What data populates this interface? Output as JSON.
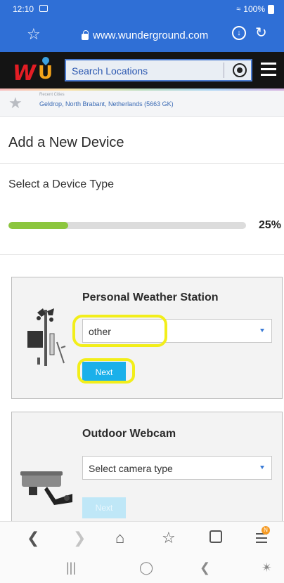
{
  "status_bar": {
    "time": "12:10",
    "battery": "100%"
  },
  "browser": {
    "url": "www.wunderground.com"
  },
  "header": {
    "search_placeholder": "Search Locations"
  },
  "recent": {
    "label": "Recent Cities",
    "city": "Geldrop, North Brabant, Netherlands (5663 GK)"
  },
  "page": {
    "title": "Add a New Device",
    "subtitle": "Select a Device Type",
    "progress_percent": 25,
    "progress_label": "25%"
  },
  "cards": [
    {
      "title": "Personal Weather Station",
      "select_value": "other",
      "button_label": "Next"
    },
    {
      "title": "Outdoor Webcam",
      "select_value": "Select camera type",
      "button_label": "Next"
    }
  ],
  "colors": {
    "browser_blue": "#2f6fd6",
    "progress_green": "#8cc63e",
    "button_blue": "#1ab0ea",
    "highlight_yellow": "#f2ee1a"
  },
  "bottom_nav": {
    "tab_count": "",
    "menu_badge": "N"
  }
}
